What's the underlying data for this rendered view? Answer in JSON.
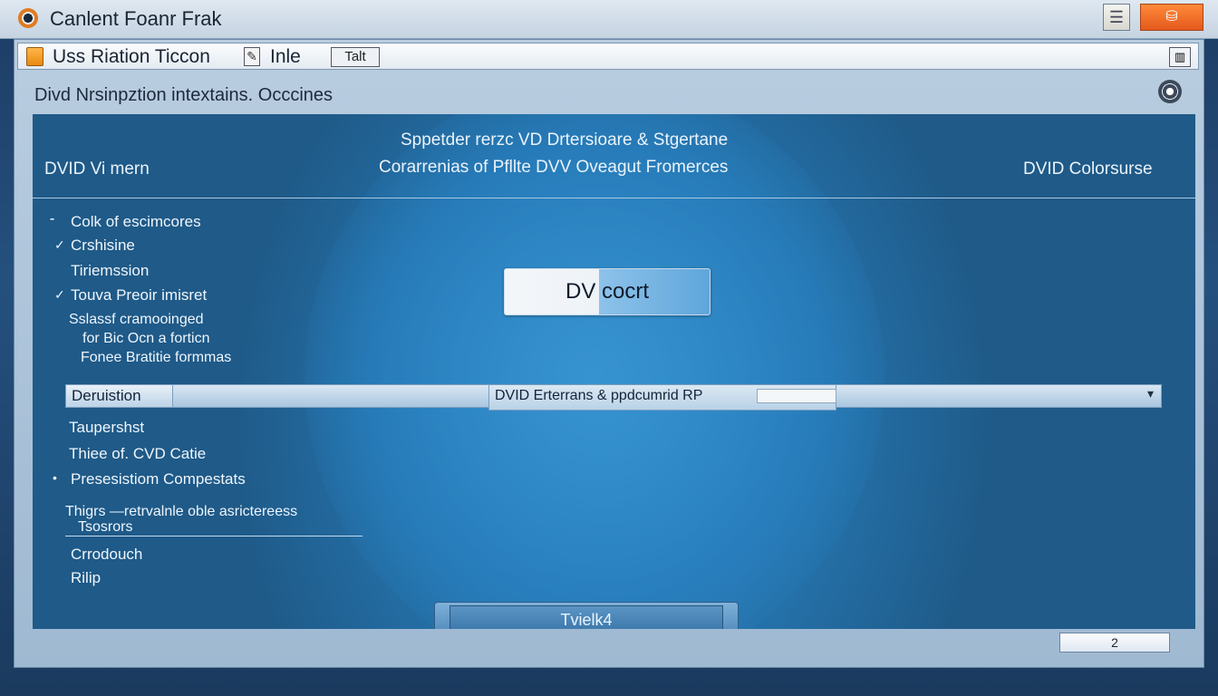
{
  "titlebar": {
    "title": "Canlent Foanr Frak",
    "doc_btn": "☰",
    "close_btn": "⛁"
  },
  "toolbar": {
    "item1": "Uss Riation Ticcon",
    "item2": "Inle",
    "tab": "Talt",
    "edit_glyph": "✎",
    "right_btn": "▥"
  },
  "subheader": {
    "text": "Divd Nrsinpztion  intextains. Occcines"
  },
  "panel": {
    "left_title": "DVID Vi mern",
    "center_line1": "Sppetder rerzc VD Drtersioare & Stgertane",
    "center_line2": "Corarrenias  of Pfllte DVV    Oveagut Fromerces",
    "right_title": "DVID Colorsurse",
    "list_top": [
      {
        "bullet": "⁃",
        "text": "Colk of escimcores"
      },
      {
        "bullet": "✓",
        "text": "Crshisine"
      },
      {
        "bullet": "",
        "text": "Tiriemssion"
      },
      {
        "bullet": "✓",
        "text": "Touva Preoir imisret"
      },
      {
        "bullet": "",
        "text": "Sslassf cramooinged"
      },
      {
        "bullet": "",
        "text": "for Bic Ocn a forticn"
      },
      {
        "bullet": "",
        "text": "Fonee Bratitie formmas"
      }
    ],
    "dvd_button": "DV cocrt",
    "combo": {
      "label": "Deruistion",
      "value": "DVID Erterrans & ppdcumrid RP",
      "arrow": "▾"
    },
    "list_bottom": [
      {
        "bullet": "",
        "text": "Taupershst"
      },
      {
        "bullet": "",
        "text": "Thiee of. CVD Catie"
      },
      {
        "bullet": "•",
        "text": "Presesistiom Compestats"
      },
      {
        "bullet": "",
        "text": "Thigrs   —retrvalnle oble asrictereess"
      },
      {
        "bullet": "",
        "text": "Tsosrors"
      },
      {
        "bullet": "",
        "text": "Crrodouch"
      },
      {
        "bullet": "",
        "text": "Rilip"
      }
    ],
    "bottom_button": "Tvielk4"
  },
  "status": {
    "value": "2"
  }
}
